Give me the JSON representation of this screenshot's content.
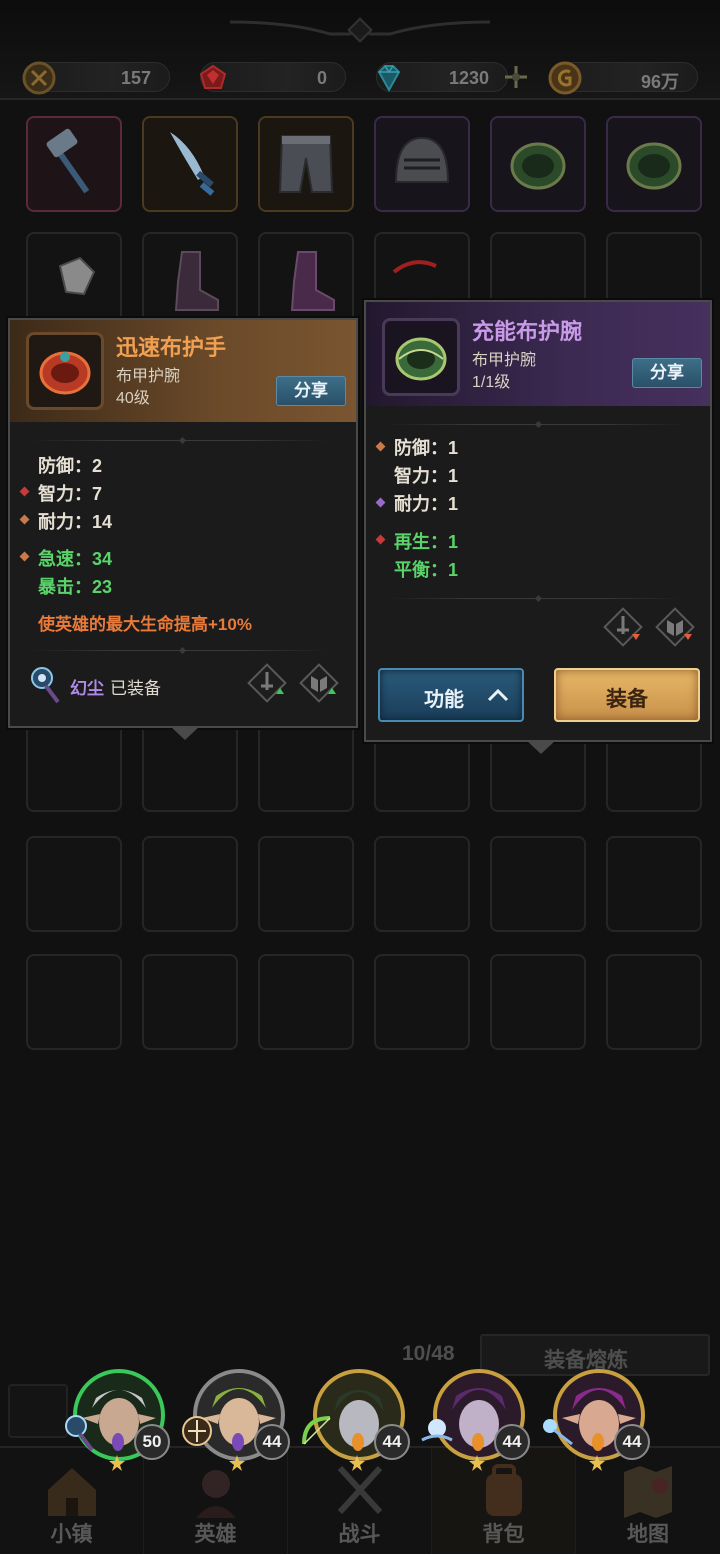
{
  "currencies": [
    {
      "id": "stamina",
      "value": "157",
      "icon": "rune-coin-icon"
    },
    {
      "id": "ruby",
      "value": "0",
      "icon": "red-gem-icon"
    },
    {
      "id": "diamond",
      "value": "1230",
      "icon": "cyan-gem-icon"
    },
    {
      "id": "gold",
      "value": "96万",
      "icon": "gold-coin-icon"
    }
  ],
  "inventory": {
    "row1": [
      {
        "icon": "hammer-icon",
        "rarity": "pink"
      },
      {
        "icon": "sword-icon",
        "rarity": "gold"
      },
      {
        "icon": "pants-icon",
        "rarity": "gold"
      },
      {
        "icon": "helmet-icon",
        "rarity": "purple"
      },
      {
        "icon": "bracer-icon",
        "rarity": "purple"
      },
      {
        "icon": "bracer-icon",
        "rarity": "purple"
      }
    ],
    "page_count": "10/48",
    "smelt_label": "装备熔炼"
  },
  "compare_left": {
    "name": "迅速布护手",
    "type": "布甲护腕",
    "level": "40级",
    "share_label": "分享",
    "icon": "red-bracer-icon",
    "stats": [
      {
        "label": "防御：2",
        "bullet": ""
      },
      {
        "label": "智力：7",
        "bullet": "red"
      },
      {
        "label": "耐力：14",
        "bullet": "orange"
      }
    ],
    "bonus_stats": [
      {
        "label": "急速：34",
        "bullet": "orange"
      },
      {
        "label": "暴击：23",
        "bullet": ""
      }
    ],
    "effect": "使英雄的最大生命提高+10%",
    "equipped_hero": "幻尘",
    "equipped_status": "已装备"
  },
  "compare_right": {
    "name": "充能布护腕",
    "type": "布甲护腕",
    "level": "1/1级",
    "share_label": "分享",
    "icon": "green-bracer-icon",
    "stats": [
      {
        "label": "防御：1",
        "bullet": "orange"
      },
      {
        "label": "智力：1",
        "bullet": ""
      },
      {
        "label": "耐力：1",
        "bullet": "purple"
      }
    ],
    "bonus_stats": [
      {
        "label": "再生：1",
        "bullet": "red"
      },
      {
        "label": "平衡：1",
        "bullet": ""
      }
    ],
    "function_label": "功能",
    "equip_label": "装备"
  },
  "heroes": [
    {
      "level": "50",
      "gem": "purple",
      "weapon": "staff-icon"
    },
    {
      "level": "44",
      "gem": "purple",
      "weapon": "rune-icon"
    },
    {
      "level": "44",
      "gem": "orange",
      "weapon": "bow-icon"
    },
    {
      "level": "44",
      "gem": "orange",
      "weapon": "orb-icon"
    },
    {
      "level": "44",
      "gem": "orange",
      "weapon": "wand-icon"
    }
  ],
  "nav": [
    {
      "label": "小镇",
      "icon": "town-icon"
    },
    {
      "label": "英雄",
      "icon": "hero-icon"
    },
    {
      "label": "战斗",
      "icon": "battle-icon"
    },
    {
      "label": "背包",
      "icon": "backpack-icon"
    },
    {
      "label": "地图",
      "icon": "map-icon"
    }
  ],
  "colors": {
    "rare_name": "#f0a050",
    "epic_name": "#c89ae8",
    "bonus_stat": "#5ad46a",
    "effect": "#e87a3a"
  }
}
